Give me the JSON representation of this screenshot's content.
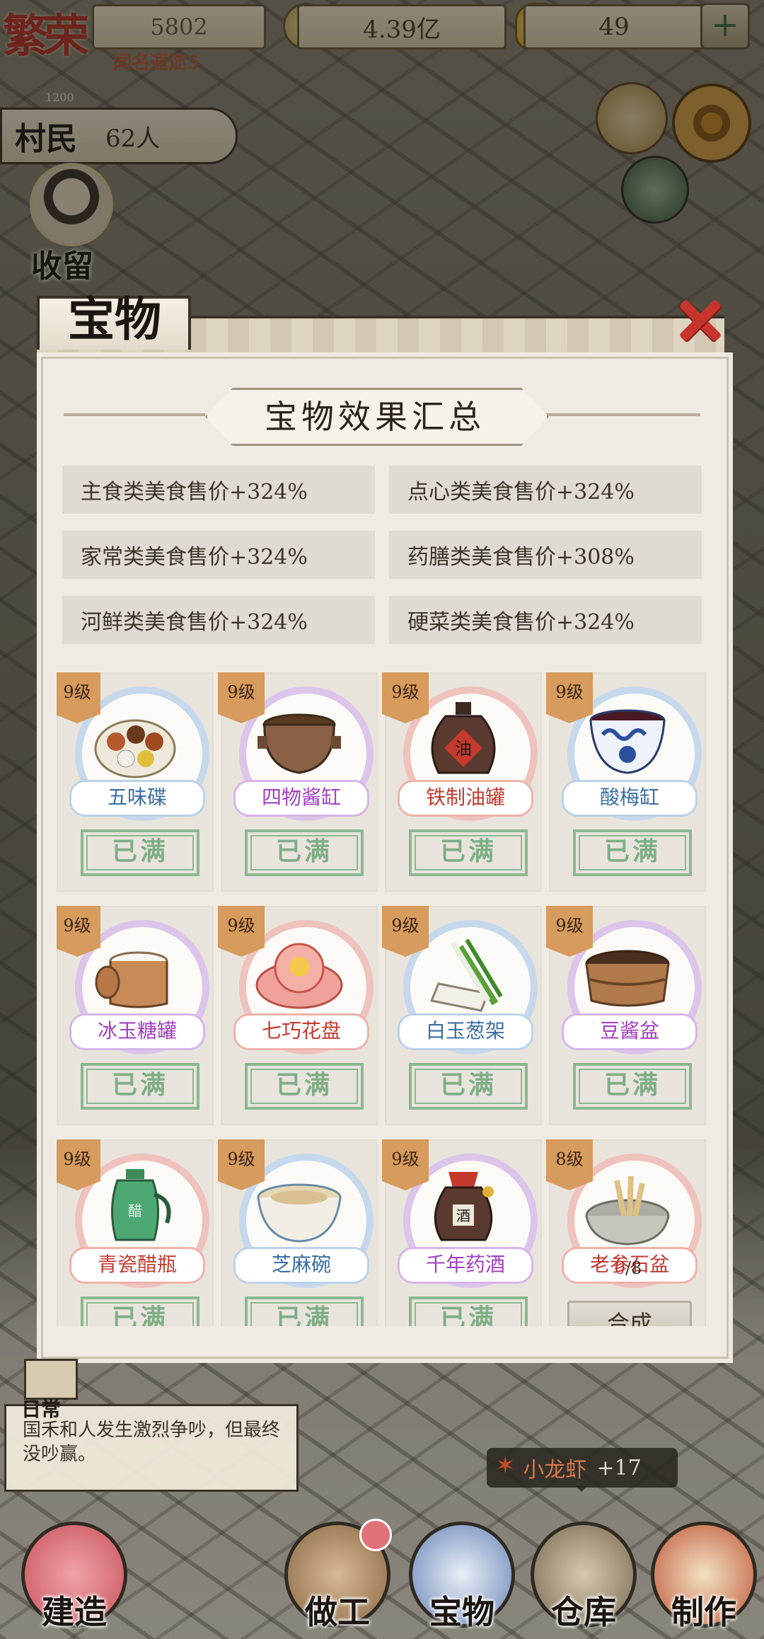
{
  "top": {
    "logo": "繁荣",
    "fame_value": "5802",
    "fame_subtitle": "闻名遐迩5",
    "coins": "4.39亿",
    "gold": "49",
    "plus_label": "+",
    "level_hint": "1200"
  },
  "villagers": {
    "label": "村民",
    "count": "62人"
  },
  "shelter": {
    "label": "收留"
  },
  "modal": {
    "title": "宝物",
    "summary_title": "宝物效果汇总",
    "effects": [
      "主食类美食售价+324%",
      "点心类美食售价+324%",
      "家常类美食售价+324%",
      "药膳类美食售价+308%",
      "河鲜类美食售价+324%",
      "硬菜类美食售价+324%"
    ],
    "items": [
      {
        "level": "9级",
        "name": "五味碟",
        "status": "已满",
        "color": "blue"
      },
      {
        "level": "9级",
        "name": "四物酱缸",
        "status": "已满",
        "color": "purple"
      },
      {
        "level": "9级",
        "name": "铁制油罐",
        "status": "已满",
        "color": "red"
      },
      {
        "level": "9级",
        "name": "酸梅缸",
        "status": "已满",
        "color": "blue"
      },
      {
        "level": "9级",
        "name": "冰玉糖罐",
        "status": "已满",
        "color": "purple"
      },
      {
        "level": "9级",
        "name": "七巧花盘",
        "status": "已满",
        "color": "red"
      },
      {
        "level": "9级",
        "name": "白玉葱架",
        "status": "已满",
        "color": "blue"
      },
      {
        "level": "9级",
        "name": "豆酱盆",
        "status": "已满",
        "color": "purple"
      },
      {
        "level": "9级",
        "name": "青瓷醋瓶",
        "status": "已满",
        "color": "red"
      },
      {
        "level": "9级",
        "name": "芝麻碗",
        "status": "已满",
        "color": "blue"
      },
      {
        "level": "9级",
        "name": "千年药酒",
        "status": "已满",
        "color": "purple"
      },
      {
        "level": "8级",
        "name": "老参石盆",
        "progress_current": "0",
        "progress_total": "/8",
        "action": "合成",
        "color": "red"
      }
    ]
  },
  "event": {
    "type": "日常",
    "text": "国禾和人发生激烈争吵，但最终没吵赢。"
  },
  "reward": {
    "name": "小龙虾",
    "amount": "+17"
  },
  "nav": [
    "建造",
    "做工",
    "宝物",
    "仓库",
    "制作"
  ]
}
